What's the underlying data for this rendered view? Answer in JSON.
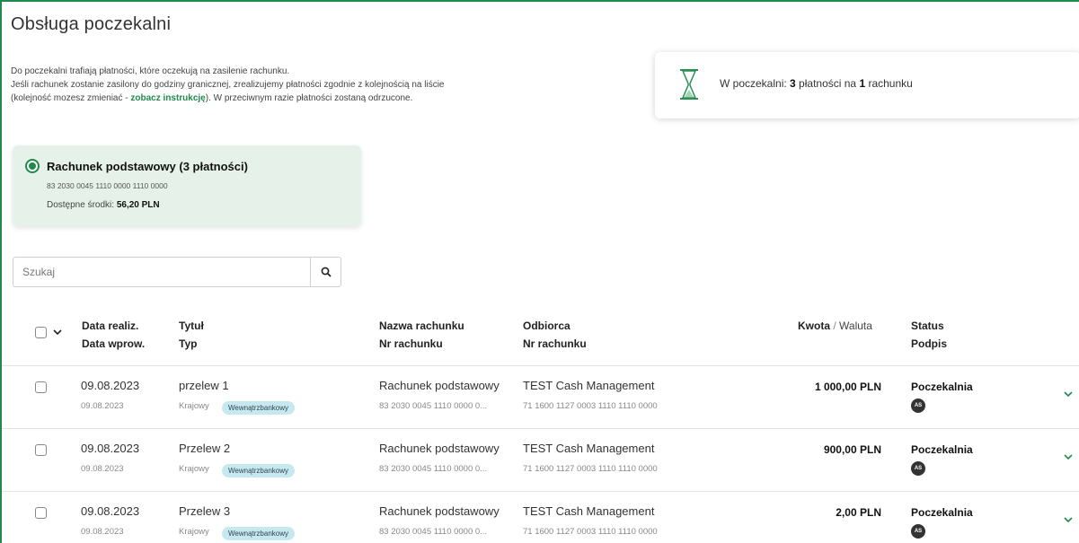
{
  "page": {
    "title": "Obsługa poczekalni",
    "intro_line1": "Do poczekalni trafiają płatności, które oczekują na zasilenie rachunku.",
    "intro_line2": "Jeśli rachunek zostanie zasilony do godziny granicznej, zrealizujemy płatności zgodnie z kolejnością na liście",
    "intro_line3_pre": "(kolejność mozesz zmieniać - ",
    "intro_link": "zobacz instrukcję",
    "intro_line3_post": "). W przeciwnym razie płatności zostaną odrzucone."
  },
  "summary": {
    "icon": "hourglass-icon",
    "prefix": "W poczekalni: ",
    "payments_count": "3",
    "middle": " płatności na ",
    "accounts_count": "1",
    "suffix": " rachunku"
  },
  "account": {
    "name": "Rachunek podstawowy (3 płatności)",
    "number": "83 2030 0045 1110 0000 1110 0000",
    "funds_label": "Dostępne środki: ",
    "funds_value": "56,20 PLN"
  },
  "search": {
    "placeholder": "Szukaj",
    "icon": "search-icon"
  },
  "table": {
    "headers": {
      "date_realiz": "Data realiz.",
      "date_wprow": "Data wprow.",
      "title": "Tytuł",
      "type": "Typ",
      "account_name": "Nazwa rachunku",
      "account_nr": "Nr rachunku",
      "recipient": "Odbiorca",
      "recipient_nr": "Nr rachunku",
      "amount": "Kwota",
      "amount_sep": " / ",
      "currency": "Waluta",
      "status": "Status",
      "signature": "Podpis"
    },
    "rows": [
      {
        "date_realiz": "09.08.2023",
        "date_wprow": "09.08.2023",
        "title": "przelew 1",
        "type": "Krajowy",
        "badge": "Wewnątrzbankowy",
        "account_name": "Rachunek podstawowy",
        "account_nr": "83 2030 0045 1110 0000 0...",
        "recipient": "TEST Cash Management",
        "recipient_nr": "71 1600 1127 0003 1110 1110 0000",
        "amount": "1 000,00 PLN",
        "status": "Poczekalnia",
        "signer": "AS"
      },
      {
        "date_realiz": "09.08.2023",
        "date_wprow": "09.08.2023",
        "title": "Przelew 2",
        "type": "Krajowy",
        "badge": "Wewnątrzbankowy",
        "account_name": "Rachunek podstawowy",
        "account_nr": "83 2030 0045 1110 0000 0...",
        "recipient": "TEST Cash Management",
        "recipient_nr": "71 1600 1127 0003 1110 1110 0000",
        "amount": "900,00 PLN",
        "status": "Poczekalnia",
        "signer": "AS"
      },
      {
        "date_realiz": "09.08.2023",
        "date_wprow": "09.08.2023",
        "title": "Przelew 3",
        "type": "Krajowy",
        "badge": "Wewnątrzbankowy",
        "account_name": "Rachunek podstawowy",
        "account_nr": "83 2030 0045 1110 0000 0...",
        "recipient": "TEST Cash Management",
        "recipient_nr": "71 1600 1127 0003 1110 1110 0000",
        "amount": "2,00 PLN",
        "status": "Poczekalnia",
        "signer": "AS"
      }
    ]
  },
  "colors": {
    "brand_green": "#1f8a4c",
    "card_green": "#e6f2e9",
    "badge_blue": "#c6e8ef"
  }
}
